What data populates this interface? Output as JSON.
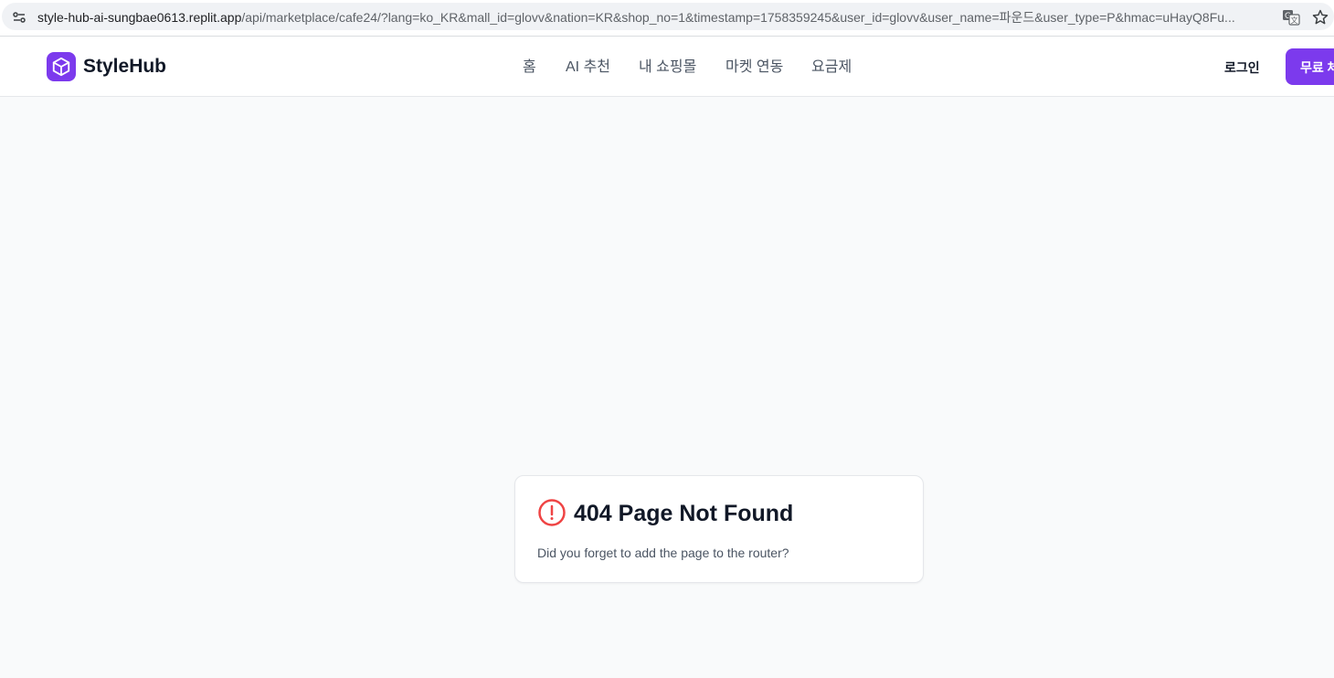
{
  "browser": {
    "url_host": "style-hub-ai-sungbae0613.replit.app",
    "url_rest": "/api/marketplace/cafe24/?lang=ko_KR&mall_id=glovv&nation=KR&shop_no=1&timestamp=1758359245&user_id=glovv&user_name=파운드&user_type=P&hmac=uHayQ8Fu...",
    "icons": [
      "site-info-icon",
      "translate-icon",
      "star-icon"
    ]
  },
  "header": {
    "brand": "StyleHub",
    "nav": [
      {
        "label": "홈"
      },
      {
        "label": "AI 추천"
      },
      {
        "label": "내 쇼핑몰"
      },
      {
        "label": "마켓 연동"
      },
      {
        "label": "요금제"
      }
    ],
    "login_label": "로그인",
    "cta_label": "무료 체"
  },
  "error_card": {
    "title": "404 Page Not Found",
    "message": "Did you forget to add the page to the router?"
  },
  "colors": {
    "brand": "#7c3aed",
    "error": "#ef4444",
    "page_bg": "#f9fafb"
  }
}
